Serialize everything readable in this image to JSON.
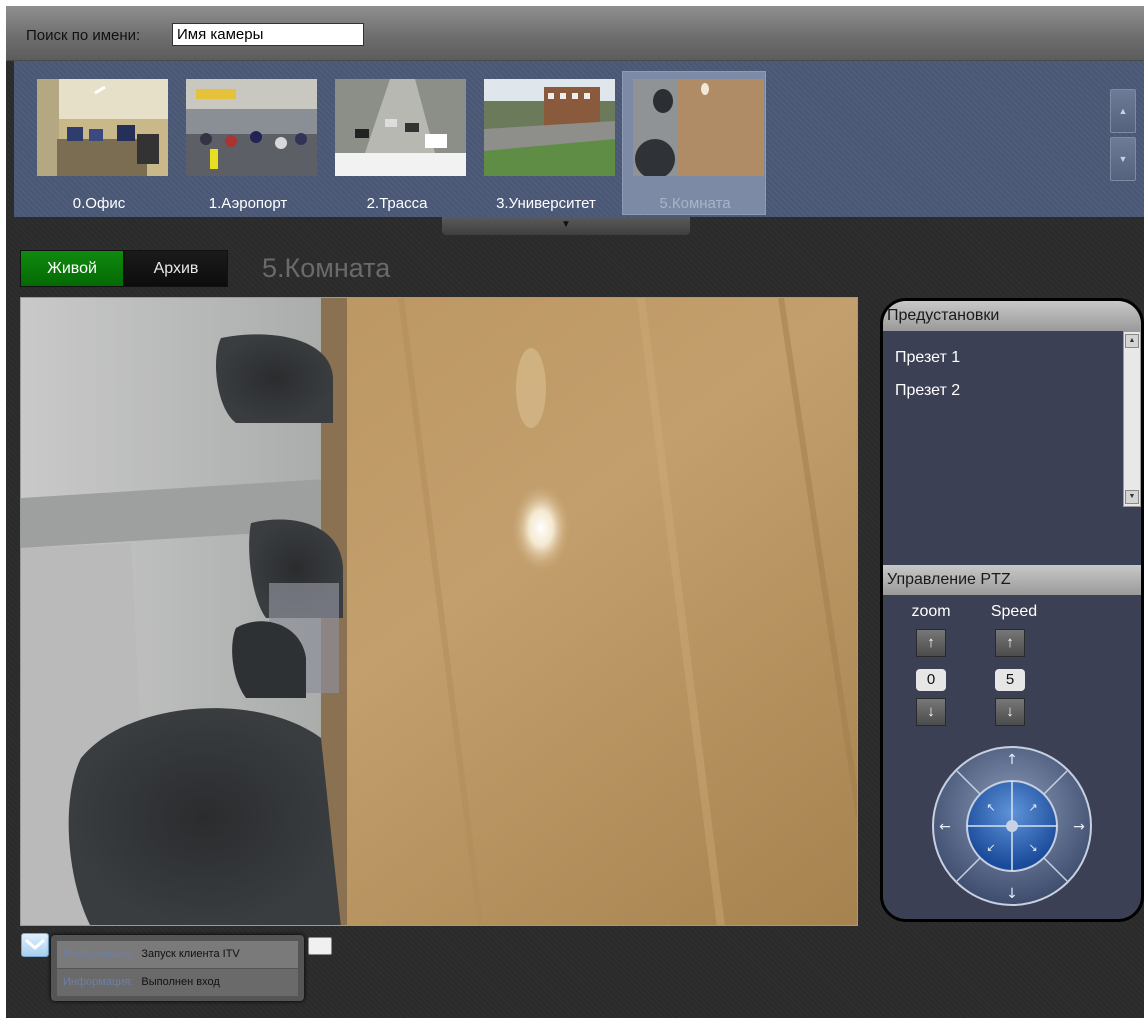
{
  "search": {
    "label": "Поиск по имени:",
    "value": "Имя камеры"
  },
  "cameras": [
    {
      "label": "0.Офис",
      "selected": false
    },
    {
      "label": "1.Аэропорт",
      "selected": false
    },
    {
      "label": "2.Трасса",
      "selected": false
    },
    {
      "label": "3.Университет",
      "selected": false
    },
    {
      "label": "5.Комната",
      "selected": true
    }
  ],
  "mode_buttons": {
    "live": "Живой",
    "archive": "Архив",
    "active": "live"
  },
  "current_camera": "5.Комната",
  "presets": {
    "header": "Предустановки",
    "items": [
      "Презет 1",
      "Презет 2"
    ]
  },
  "ptz": {
    "header": "Управление PTZ",
    "zoom_label": "zoom",
    "speed_label": "Speed",
    "zoom_value": "0",
    "speed_value": "5"
  },
  "info": {
    "messages": [
      {
        "type": "Информация:",
        "text": "Запуск клиента ITV"
      },
      {
        "type": "Информация:",
        "text": "Выполнен вход"
      }
    ]
  },
  "colors": {
    "accent_live": "#0a7d0a",
    "strip": "#4a5876",
    "panel": "#3b4054"
  }
}
